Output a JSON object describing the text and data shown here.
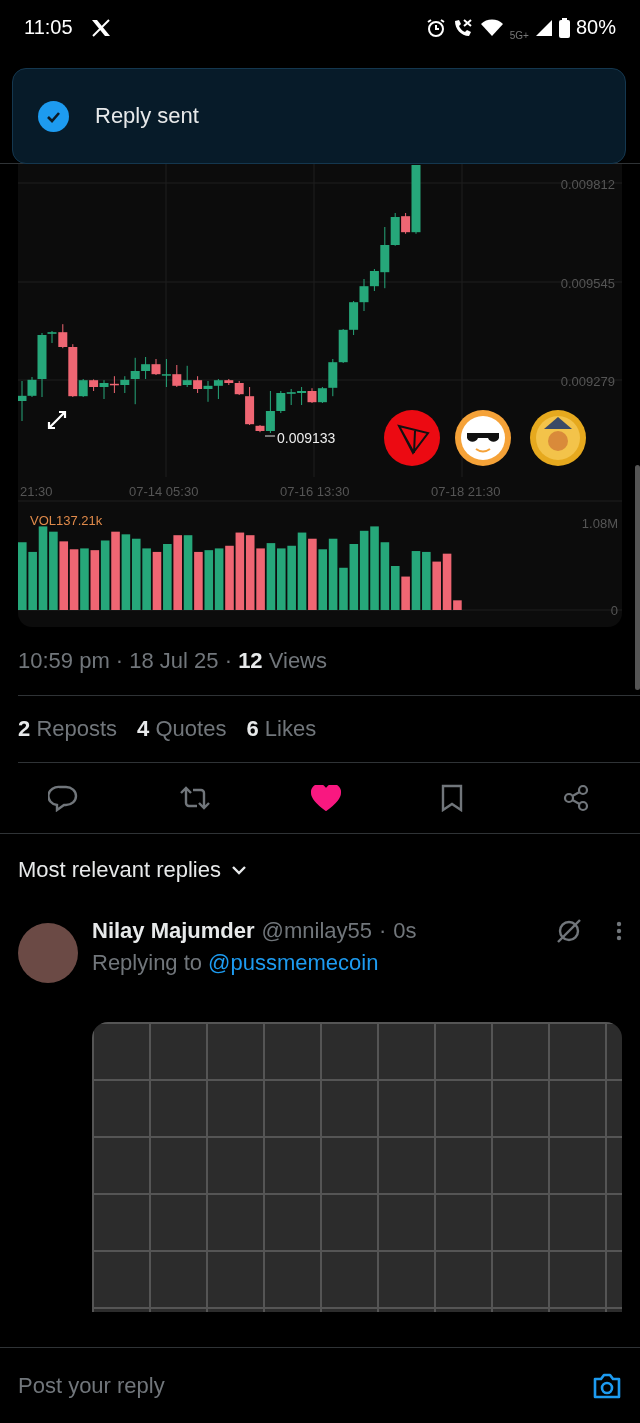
{
  "status_bar": {
    "time": "11:05",
    "network": "5G+",
    "battery": "80%"
  },
  "toast": {
    "text": "Reply sent"
  },
  "chart_image": {
    "price_labels": [
      "0.009812",
      "0.009545",
      "0.009279"
    ],
    "low_label": "0.009133",
    "time_labels": [
      "21:30",
      "07-14 05:30",
      "07-16 13:30",
      "07-18 21:30"
    ],
    "volume_label": "VOL137.21k",
    "volume_axis_labels": [
      "1.08M",
      "0"
    ]
  },
  "meta": "10:59 pm · 18 Jul 25 · **12** Views",
  "stats": [
    {
      "count": "2",
      "label": "Reposts"
    },
    {
      "count": "4",
      "label": "Quotes"
    },
    {
      "count": "6",
      "label": "Likes"
    }
  ],
  "actions": [
    {
      "kind": "reply",
      "active": false
    },
    {
      "kind": "repost",
      "active": false
    },
    {
      "kind": "like",
      "active": true
    },
    {
      "kind": "bookmark",
      "active": false
    },
    {
      "kind": "share",
      "active": false
    }
  ],
  "sort": {
    "label": "Most relevant replies"
  },
  "reply": {
    "name": "Nilay Majumder",
    "handle": "@mnilay55",
    "separator": "·",
    "time": "0s",
    "replying_prefix": "Replying to",
    "mention": "@pussmemecoin"
  },
  "composer": {
    "placeholder": "Post your reply"
  }
}
